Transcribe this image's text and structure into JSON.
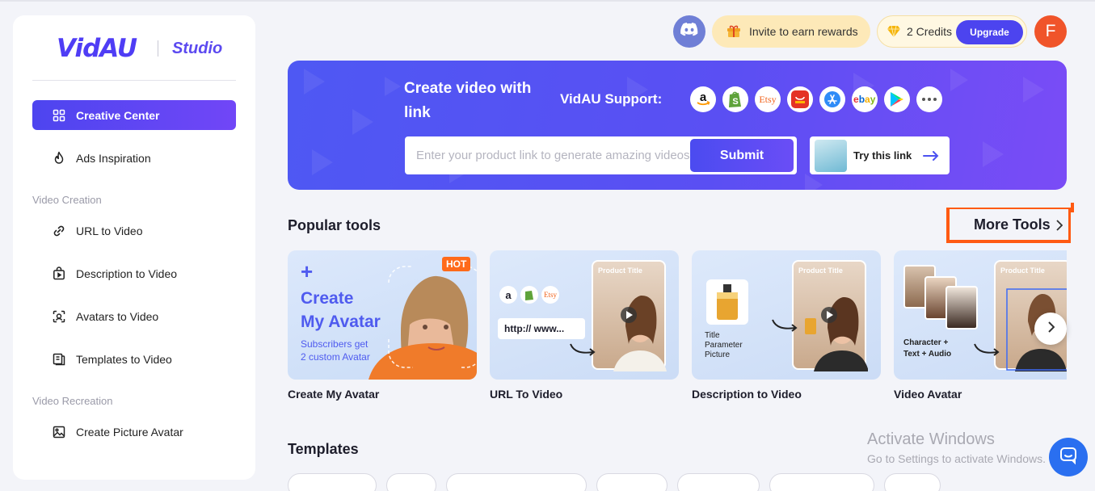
{
  "brand": {
    "name": "VidAU",
    "product": "Studio"
  },
  "sidebar": {
    "items": [
      {
        "label": "Creative Center",
        "icon": "grid-icon",
        "active": true
      },
      {
        "label": "Ads Inspiration",
        "icon": "fire-icon"
      }
    ],
    "sections": [
      {
        "title": "Video Creation",
        "items": [
          {
            "label": "URL to Video",
            "icon": "link-icon"
          },
          {
            "label": "Description to Video",
            "icon": "bag-icon"
          },
          {
            "label": "Avatars to Video",
            "icon": "face-scan-icon"
          },
          {
            "label": "Templates to Video",
            "icon": "template-icon"
          }
        ]
      },
      {
        "title": "Video Recreation",
        "items": [
          {
            "label": "Create Picture Avatar",
            "icon": "image-icon"
          }
        ]
      }
    ]
  },
  "topbar": {
    "invite_label": "Invite to earn rewards",
    "credits_label": "2 Credits",
    "upgrade_label": "Upgrade",
    "avatar_initial": "F"
  },
  "banner": {
    "title": "Create video with link",
    "support_label": "VidAU Support:",
    "platforms": [
      "amazon-icon",
      "shopify-icon",
      "etsy-icon",
      "aliexpress-icon",
      "app-store-icon",
      "ebay-icon",
      "google-play-icon",
      "more-icon"
    ],
    "input_placeholder": "Enter your product link to generate amazing videos",
    "submit_label": "Submit",
    "try_label": "Try this link"
  },
  "popular": {
    "title": "Popular tools",
    "more_label": "More Tools",
    "cards": [
      {
        "label": "Create My Avatar",
        "badge": "HOT",
        "heading_line1": "Create",
        "heading_line2": "My Avatar",
        "sub_line1": "Subscribers get",
        "sub_line2": "2 custom Avatar"
      },
      {
        "label": "URL To Video",
        "product_title": "Product Title",
        "url_text": "http:// www..."
      },
      {
        "label": "Description to Video",
        "product_title": "Product Title",
        "param_text": "Title\nParameter\nPicture"
      },
      {
        "label": "Video Avatar",
        "product_title": "Product Title",
        "char_text": "Character +\nText + Audio"
      }
    ]
  },
  "templates": {
    "title": "Templates"
  },
  "os_notice": {
    "line1": "Activate Windows",
    "line2": "Go to Settings to activate Windows."
  },
  "colors": {
    "accent": "#4c44ef",
    "highlight": "#ff5a12",
    "avatar_bg": "#f0542a"
  }
}
